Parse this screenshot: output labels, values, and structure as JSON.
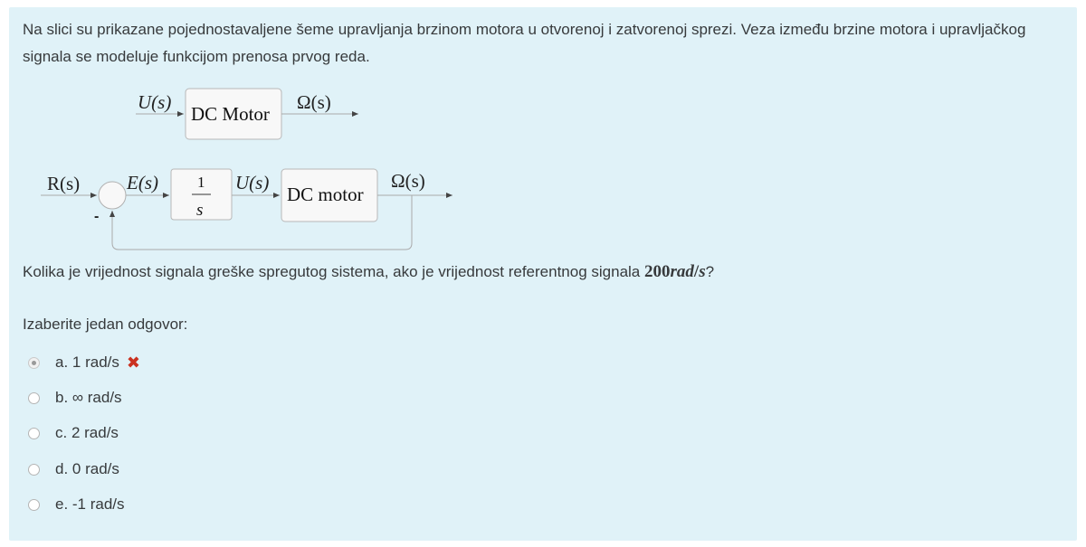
{
  "question": {
    "intro": "Na slici su prikazane pojednostavaljene šeme upravljanja brzinom motora u otvorenoj i zatvorenoj sprezi. Veza između brzine motora i upravljačkog signala se modeluje funkcijom prenosa prvog reda.",
    "prompt_before": "Kolika je vrijednost signala greške spregutog sistema, ako je vrijednost referentnog signala ",
    "prompt_math_num": "200",
    "prompt_math_unit": "rad",
    "prompt_math_slash": "/",
    "prompt_math_s": "s",
    "prompt_after": "?",
    "select_label": "Izaberite jedan odgovor:"
  },
  "diagram": {
    "open_loop": {
      "input_label": "U(s)",
      "block_label": "DC Motor",
      "output_label": "Ω(s)"
    },
    "closed_loop": {
      "reference_label": "R(s)",
      "error_label": "E(s)",
      "controller_num": "1",
      "controller_den": "s",
      "control_label": "U(s)",
      "block_label": "DC motor",
      "output_label": "Ω(s)",
      "feedback_sign": "-"
    }
  },
  "answers": [
    {
      "label": "a. 1 rad/s",
      "selected": true,
      "wrong": true
    },
    {
      "label": "b. ∞ rad/s",
      "selected": false,
      "wrong": false
    },
    {
      "label": "c. 2 rad/s",
      "selected": false,
      "wrong": false
    },
    {
      "label": "d. 0 rad/s",
      "selected": false,
      "wrong": false
    },
    {
      "label": "e. -1 rad/s",
      "selected": false,
      "wrong": false
    }
  ],
  "feedback_icon": "✖",
  "colors": {
    "panel": "#e0f2f8",
    "wrong": "#ca3120",
    "text": "#373a3c"
  }
}
